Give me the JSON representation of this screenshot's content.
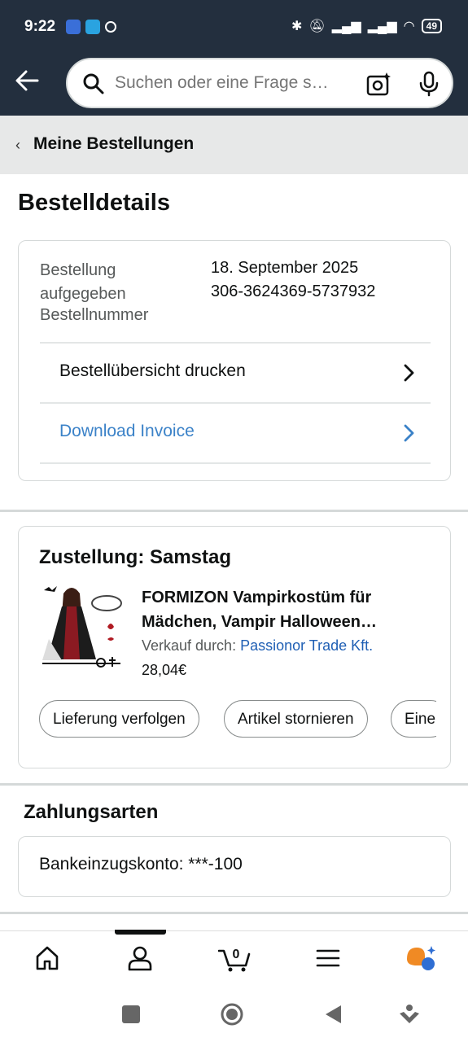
{
  "status_bar": {
    "time": "9:22",
    "battery": "49"
  },
  "search": {
    "placeholder": "Suchen oder eine Frage s…"
  },
  "breadcrumb": {
    "label": "Meine Bestellungen"
  },
  "page_title": "Bestelldetails",
  "order": {
    "placed_label": "Bestellung aufgegeben",
    "number_label": "Bestellnummer",
    "placed_date": "18. September 2025",
    "order_number": "306-3624369-5737932",
    "print_summary_label": "Bestellübersicht drucken",
    "download_invoice_label": "Download Invoice"
  },
  "delivery": {
    "title": "Zustellung: Samstag",
    "product_title": "FORMIZON Vampirkostüm für Mädchen, Vampir Halloween…",
    "sold_by_label": "Verkauf durch: ",
    "seller": "Passionor Trade Kft.",
    "price": "28,04€",
    "buttons": [
      "Lieferung verfolgen",
      "Artikel stornieren",
      "Eine"
    ]
  },
  "payment": {
    "title": "Zahlungsarten",
    "method": "Bankeinzugskonto: ***-100"
  },
  "bottom_nav": {
    "cart_count": "0",
    "items": [
      "home-icon",
      "account-icon",
      "cart-icon",
      "menu-icon",
      "rufus-icon"
    ]
  },
  "colors": {
    "header": "#232f3e",
    "link": "#1f5fb4",
    "invoice_link": "#3b82c8",
    "breadcrumb_bg": "#e7e8e8"
  }
}
